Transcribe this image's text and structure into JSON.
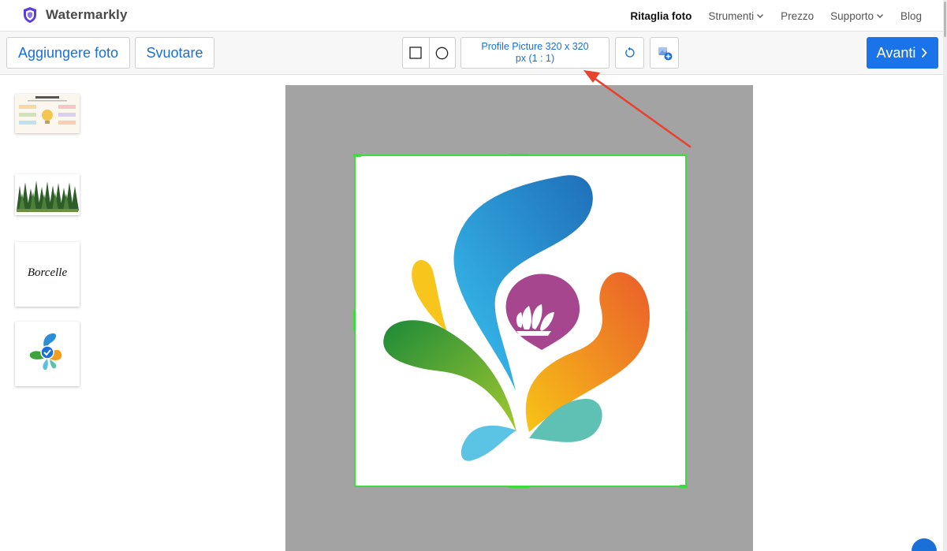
{
  "brand": {
    "name": "Watermarkly",
    "logo_icon": "shield-icon",
    "logo_color": "#5b3fd6"
  },
  "nav": {
    "items": [
      {
        "label": "Ritaglia foto",
        "active": true,
        "dropdown": false
      },
      {
        "label": "Strumenti",
        "active": false,
        "dropdown": true
      },
      {
        "label": "Prezzo",
        "active": false,
        "dropdown": false
      },
      {
        "label": "Supporto",
        "active": false,
        "dropdown": true
      },
      {
        "label": "Blog",
        "active": false,
        "dropdown": false
      }
    ]
  },
  "toolbar": {
    "add_photo_label": "Aggiungere foto",
    "clear_label": "Svuotare",
    "shape_options": [
      "rectangle-icon",
      "circle-icon"
    ],
    "preset_line1": "Profile Picture 320 x 320",
    "preset_line2": "px (1 : 1)",
    "rotate_icon": "rotate-icon",
    "add_crop_icon": "add-crop-icon",
    "next_label": "Avanti",
    "accent_color": "#1a73e8"
  },
  "sidebar": {
    "thumbnails": [
      {
        "kind": "infographic"
      },
      {
        "kind": "forest"
      },
      {
        "kind": "logo-text",
        "text": "Borcelle"
      },
      {
        "kind": "splash-logo-selected"
      }
    ]
  },
  "crop": {
    "frame_color": "#3bdc3b",
    "canvas_color": "#a3a3a3",
    "aspect_ratio": "1 : 1"
  },
  "annotation": {
    "arrow_color": "#e8432e"
  }
}
